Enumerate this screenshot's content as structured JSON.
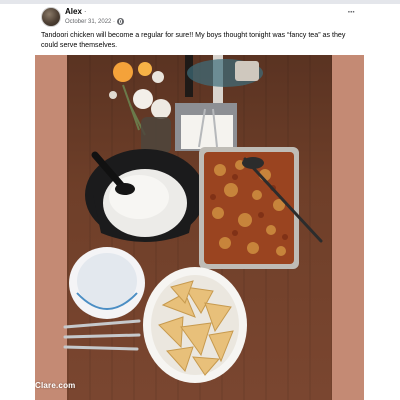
{
  "post": {
    "author": "Alex",
    "author_separator": "·",
    "date": "October 31, 2022 ·",
    "privacy_icon": "globe-icon",
    "more_icon": "more-options-icon",
    "more_label": "···",
    "text": "Tandoori chicken will become a regular for sure!! My boys thought tonight was “fancy tea” as they could serve themselves."
  },
  "photo": {
    "description_icon": "dinner-table-photo",
    "watermark": "Clare.com"
  },
  "colors": {
    "backdrop": "#c48a74",
    "table_wood": "#6f3f29",
    "text": "#050505",
    "meta_text": "#65676b"
  }
}
